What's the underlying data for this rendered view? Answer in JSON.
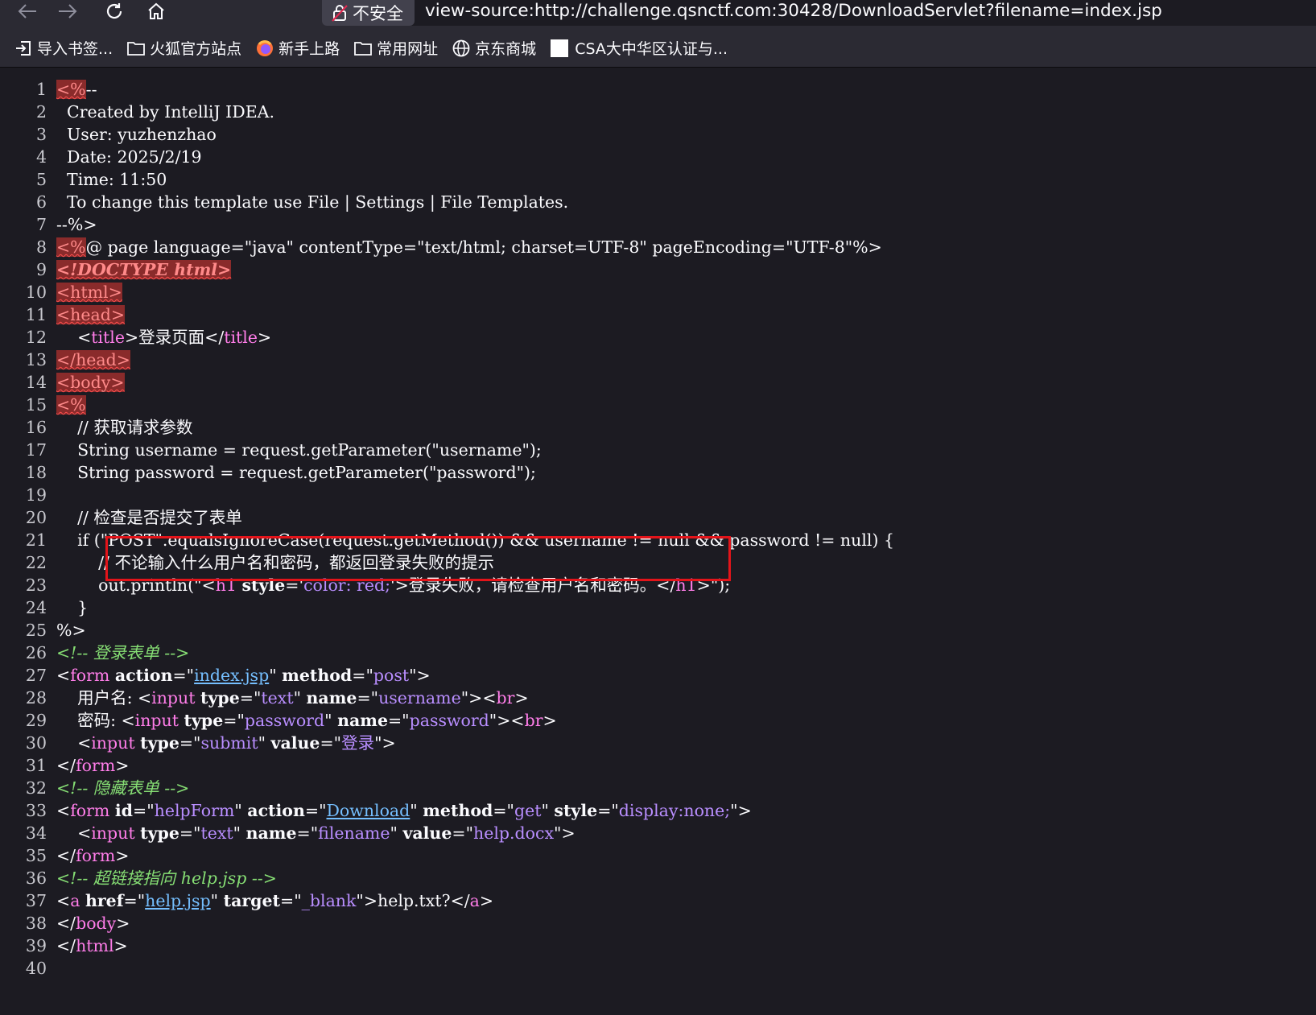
{
  "browser": {
    "back_icon": "arrow-left-icon",
    "forward_icon": "arrow-right-icon",
    "reload_icon": "reload-icon",
    "home_icon": "home-icon",
    "security_label": "不安全",
    "url": "view-source:http://challenge.qsnctf.com:30428/DownloadServlet?filename=index.jsp"
  },
  "bookmarks": [
    {
      "label": "导入书签...",
      "icon": "import-icon"
    },
    {
      "label": "火狐官方站点",
      "icon": "folder-icon"
    },
    {
      "label": "新手上路",
      "icon": "firefox-icon"
    },
    {
      "label": "常用网址",
      "icon": "folder-icon"
    },
    {
      "label": "京东商城",
      "icon": "globe-icon"
    },
    {
      "label": "CSA大中华区认证与...",
      "icon": "blank-page-icon"
    }
  ],
  "source": {
    "line_numbers": [
      "1",
      "2",
      "3",
      "4",
      "5",
      "6",
      "7",
      "8",
      "9",
      "10",
      "11",
      "12",
      "13",
      "14",
      "15",
      "16",
      "17",
      "18",
      "19",
      "20",
      "21",
      "22",
      "23",
      "24",
      "25",
      "26",
      "27",
      "28",
      "29",
      "30",
      "31",
      "32",
      "33",
      "34",
      "35",
      "36",
      "37",
      "38",
      "39",
      "40"
    ],
    "lines": [
      [
        {
          "t": "<%",
          "c": "err"
        },
        {
          "t": "--"
        }
      ],
      [
        {
          "t": "  Created by IntelliJ IDEA."
        }
      ],
      [
        {
          "t": "  User: yuzhenzhao"
        }
      ],
      [
        {
          "t": "  Date: 2025/2/19"
        }
      ],
      [
        {
          "t": "  Time: 11:50"
        }
      ],
      [
        {
          "t": "  To change this template use File | Settings | File Templates."
        }
      ],
      [
        {
          "t": "--%>"
        }
      ],
      [
        {
          "t": "<%",
          "c": "err"
        },
        {
          "t": "@ page language=\"java\" contentType=\"text/html; charset=UTF-8\" pageEncoding=\"UTF-8\"%>"
        }
      ],
      [
        {
          "t": "<!DOCTYPE html>",
          "c": "err errb"
        }
      ],
      [
        {
          "t": "<html>",
          "c": "err"
        }
      ],
      [
        {
          "t": "<head>",
          "c": "err"
        }
      ],
      [
        {
          "t": "    <"
        },
        {
          "t": "title",
          "c": "tag"
        },
        {
          "t": ">登录页面</"
        },
        {
          "t": "title",
          "c": "tag"
        },
        {
          "t": ">"
        }
      ],
      [
        {
          "t": "</head>",
          "c": "err"
        }
      ],
      [
        {
          "t": "<body>",
          "c": "err"
        }
      ],
      [
        {
          "t": "<%",
          "c": "err"
        }
      ],
      [
        {
          "t": "    // 获取请求参数"
        }
      ],
      [
        {
          "t": "    String username = request.getParameter(\"username\");"
        }
      ],
      [
        {
          "t": "    String password = request.getParameter(\"password\");"
        }
      ],
      [
        {
          "t": ""
        }
      ],
      [
        {
          "t": "    // 检查是否提交了表单"
        }
      ],
      [
        {
          "t": "    if (\"POST\".equalsIgnoreCase(request.getMethod()) && username != null && password != null) {"
        }
      ],
      [
        {
          "t": "        // 不论输入什么用户名和密码，都返回登录失败的提示"
        }
      ],
      [
        {
          "t": "        out.println(\"<"
        },
        {
          "t": "h1",
          "c": "tag"
        },
        {
          "t": " "
        },
        {
          "t": "style",
          "c": "attr"
        },
        {
          "t": "='"
        },
        {
          "t": "color: red;",
          "c": "val"
        },
        {
          "t": "'>登录失败，请检查用户名和密码。</"
        },
        {
          "t": "h1",
          "c": "tag"
        },
        {
          "t": ">\");"
        }
      ],
      [
        {
          "t": "    }"
        }
      ],
      [
        {
          "t": "%>"
        }
      ],
      [
        {
          "t": "<!-- 登录表单 -->",
          "c": "cmt"
        }
      ],
      [
        {
          "t": "<"
        },
        {
          "t": "form",
          "c": "tag"
        },
        {
          "t": " "
        },
        {
          "t": "action",
          "c": "attr"
        },
        {
          "t": "=\""
        },
        {
          "t": "index.jsp",
          "c": "lnk"
        },
        {
          "t": "\" "
        },
        {
          "t": "method",
          "c": "attr"
        },
        {
          "t": "=\""
        },
        {
          "t": "post",
          "c": "val"
        },
        {
          "t": "\">"
        }
      ],
      [
        {
          "t": "    用户名: <"
        },
        {
          "t": "input",
          "c": "tag"
        },
        {
          "t": " "
        },
        {
          "t": "type",
          "c": "attr"
        },
        {
          "t": "=\""
        },
        {
          "t": "text",
          "c": "val"
        },
        {
          "t": "\" "
        },
        {
          "t": "name",
          "c": "attr"
        },
        {
          "t": "=\""
        },
        {
          "t": "username",
          "c": "val"
        },
        {
          "t": "\"><"
        },
        {
          "t": "br",
          "c": "tag"
        },
        {
          "t": ">"
        }
      ],
      [
        {
          "t": "    密码: <"
        },
        {
          "t": "input",
          "c": "tag"
        },
        {
          "t": " "
        },
        {
          "t": "type",
          "c": "attr"
        },
        {
          "t": "=\""
        },
        {
          "t": "password",
          "c": "val"
        },
        {
          "t": "\" "
        },
        {
          "t": "name",
          "c": "attr"
        },
        {
          "t": "=\""
        },
        {
          "t": "password",
          "c": "val"
        },
        {
          "t": "\"><"
        },
        {
          "t": "br",
          "c": "tag"
        },
        {
          "t": ">"
        }
      ],
      [
        {
          "t": "    <"
        },
        {
          "t": "input",
          "c": "tag"
        },
        {
          "t": " "
        },
        {
          "t": "type",
          "c": "attr"
        },
        {
          "t": "=\""
        },
        {
          "t": "submit",
          "c": "val"
        },
        {
          "t": "\" "
        },
        {
          "t": "value",
          "c": "attr"
        },
        {
          "t": "=\""
        },
        {
          "t": "登录",
          "c": "val"
        },
        {
          "t": "\">"
        }
      ],
      [
        {
          "t": "</"
        },
        {
          "t": "form",
          "c": "tag"
        },
        {
          "t": ">"
        }
      ],
      [
        {
          "t": "<!-- 隐藏表单 -->",
          "c": "cmt"
        }
      ],
      [
        {
          "t": "<"
        },
        {
          "t": "form",
          "c": "tag"
        },
        {
          "t": " "
        },
        {
          "t": "id",
          "c": "attr"
        },
        {
          "t": "=\""
        },
        {
          "t": "helpForm",
          "c": "val"
        },
        {
          "t": "\" "
        },
        {
          "t": "action",
          "c": "attr"
        },
        {
          "t": "=\""
        },
        {
          "t": "Download",
          "c": "lnk"
        },
        {
          "t": "\" "
        },
        {
          "t": "method",
          "c": "attr"
        },
        {
          "t": "=\""
        },
        {
          "t": "get",
          "c": "val"
        },
        {
          "t": "\" "
        },
        {
          "t": "style",
          "c": "attr"
        },
        {
          "t": "=\""
        },
        {
          "t": "display:none;",
          "c": "val"
        },
        {
          "t": "\">"
        }
      ],
      [
        {
          "t": "    <"
        },
        {
          "t": "input",
          "c": "tag"
        },
        {
          "t": " "
        },
        {
          "t": "type",
          "c": "attr"
        },
        {
          "t": "=\""
        },
        {
          "t": "text",
          "c": "val"
        },
        {
          "t": "\" "
        },
        {
          "t": "name",
          "c": "attr"
        },
        {
          "t": "=\""
        },
        {
          "t": "filename",
          "c": "val"
        },
        {
          "t": "\" "
        },
        {
          "t": "value",
          "c": "attr"
        },
        {
          "t": "=\""
        },
        {
          "t": "help.docx",
          "c": "val"
        },
        {
          "t": "\">"
        }
      ],
      [
        {
          "t": "</"
        },
        {
          "t": "form",
          "c": "tag"
        },
        {
          "t": ">"
        }
      ],
      [
        {
          "t": "<!-- 超链接指向 help.jsp -->",
          "c": "cmt"
        }
      ],
      [
        {
          "t": "<"
        },
        {
          "t": "a",
          "c": "tag"
        },
        {
          "t": " "
        },
        {
          "t": "href",
          "c": "attr"
        },
        {
          "t": "=\""
        },
        {
          "t": "help.jsp",
          "c": "lnk"
        },
        {
          "t": "\" "
        },
        {
          "t": "target",
          "c": "attr"
        },
        {
          "t": "=\""
        },
        {
          "t": "_blank",
          "c": "val"
        },
        {
          "t": "\">help.txt?</"
        },
        {
          "t": "a",
          "c": "tag"
        },
        {
          "t": ">"
        }
      ],
      [
        {
          "t": "</"
        },
        {
          "t": "body",
          "c": "tag"
        },
        {
          "t": ">"
        }
      ],
      [
        {
          "t": "</"
        },
        {
          "t": "html",
          "c": "tag"
        },
        {
          "t": ">"
        }
      ],
      [
        {
          "t": ""
        }
      ]
    ]
  },
  "colors": {
    "highlight_box": "#e3141a",
    "tag": "#ff7de9",
    "value": "#b98eff",
    "comment": "#86de74",
    "link": "#75bfff",
    "error_bg": "#8a2b2b"
  }
}
